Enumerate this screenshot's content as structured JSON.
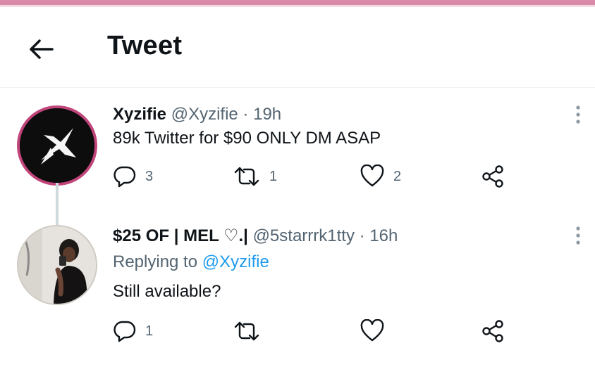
{
  "header": {
    "title": "Tweet",
    "back_icon": "arrow-left-icon"
  },
  "tweets": [
    {
      "display_name": "Xyzifie",
      "handle": "@Xyzifie",
      "separator": "·",
      "time": "19h",
      "text": "89k Twitter for $90 ONLY DM ASAP",
      "reply_count": "3",
      "retweet_count": "1",
      "like_count": "2"
    },
    {
      "display_name": "$25 OF | MEL ♡.|",
      "handle": "@5starrrk1tty",
      "separator": "·",
      "time": "16h",
      "replying_label": "Replying to",
      "replying_to": "@Xyzifie",
      "text": "Still available?",
      "reply_count": "1",
      "retweet_count": "",
      "like_count": ""
    }
  ],
  "colors": {
    "accent": "#1d9bf0",
    "muted": "#536471",
    "avatar_ring": "#c1457a",
    "top_strip": "#d98aa8"
  },
  "icons": [
    "arrow-left-icon",
    "reply-icon",
    "retweet-icon",
    "like-icon",
    "share-icon",
    "more-vertical-icon",
    "x-logo-icon"
  ]
}
